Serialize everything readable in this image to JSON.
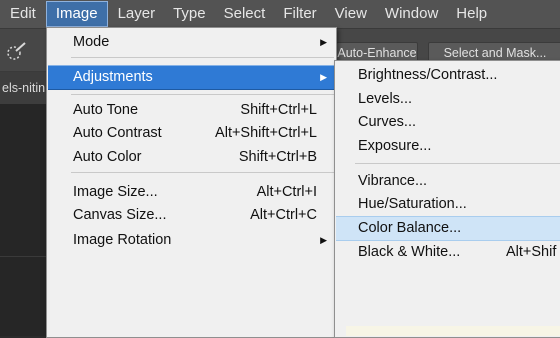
{
  "menubar": {
    "items": [
      "Edit",
      "Image",
      "Layer",
      "Type",
      "Select",
      "Filter",
      "View",
      "Window",
      "Help"
    ]
  },
  "options": {
    "auto_enhance": "Auto-Enhance",
    "select_mask": "Select and Mask...",
    "brush_icon": "quick-selection-brush-icon"
  },
  "document": {
    "tab_label": "els-nitin"
  },
  "image_menu": {
    "mode": "Mode",
    "adjustments": "Adjustments",
    "auto_tone": {
      "label": "Auto Tone",
      "shortcut": "Shift+Ctrl+L"
    },
    "auto_contrast": {
      "label": "Auto Contrast",
      "shortcut": "Alt+Shift+Ctrl+L"
    },
    "auto_color": {
      "label": "Auto Color",
      "shortcut": "Shift+Ctrl+B"
    },
    "image_size": {
      "label": "Image Size...",
      "shortcut": "Alt+Ctrl+I"
    },
    "canvas_size": {
      "label": "Canvas Size...",
      "shortcut": "Alt+Ctrl+C"
    },
    "image_rotation": "Image Rotation"
  },
  "adjustments_menu": {
    "brightness": "Brightness/Contrast...",
    "levels": "Levels...",
    "curves": "Curves...",
    "exposure": "Exposure...",
    "vibrance": "Vibrance...",
    "hue_saturation": "Hue/Saturation...",
    "color_balance": "Color Balance...",
    "black_white": {
      "label": "Black & White...",
      "shortcut": "Alt+Shif"
    }
  },
  "colors": {
    "menubar_bg": "#535353",
    "highlight": "#2f7ad5",
    "hover": "#cfe4f7",
    "menu_bg": "#f0f0f0"
  }
}
